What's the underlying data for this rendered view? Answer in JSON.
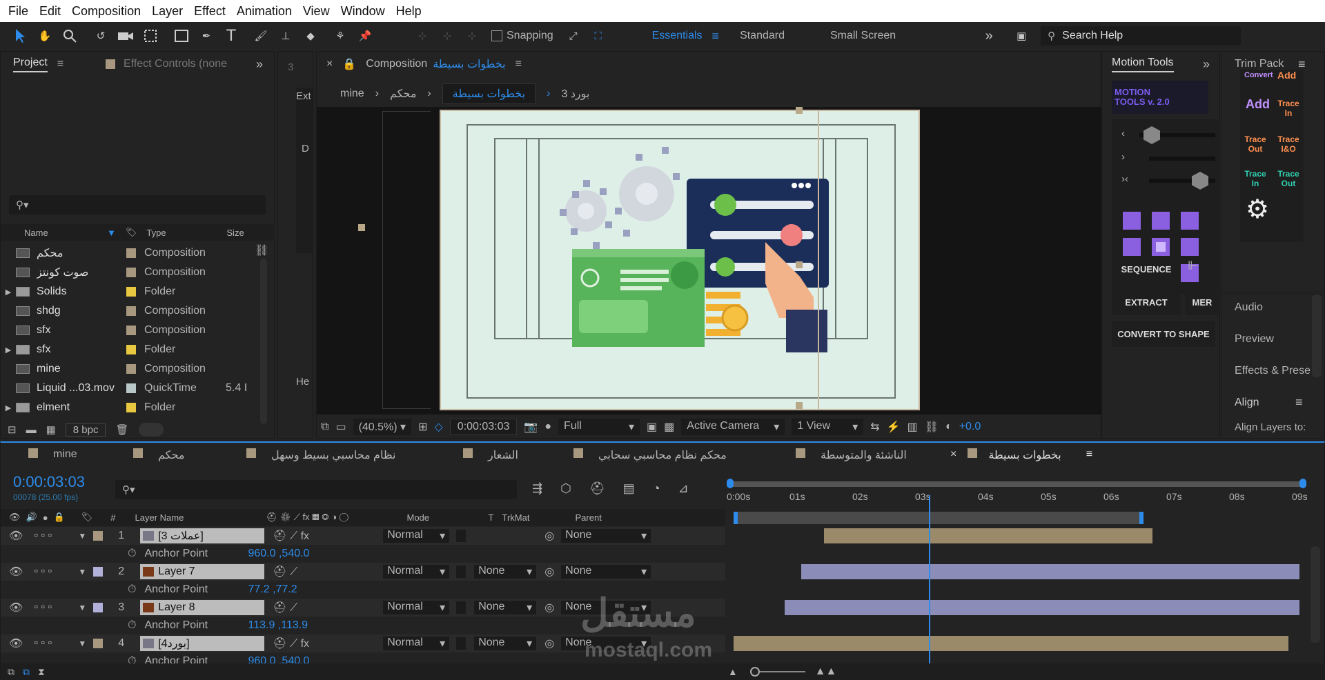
{
  "menu": [
    "File",
    "Edit",
    "Composition",
    "Layer",
    "Effect",
    "Animation",
    "View",
    "Window",
    "Help"
  ],
  "toolbar": {
    "snapping_label": "Snapping",
    "workspaces": [
      "Essentials",
      "Standard",
      "Small Screen"
    ],
    "active_workspace": "Essentials",
    "search_placeholder": "Search Help"
  },
  "project_panel": {
    "tab": "Project",
    "tab2": "Effect Controls (none",
    "columns": {
      "name": "Name",
      "type": "Type",
      "size": "Size"
    },
    "items": [
      {
        "name": "محكم",
        "type": "Composition",
        "size": "",
        "color": "#a89880",
        "kind": "comp"
      },
      {
        "name": "صوت كونتز",
        "type": "Composition",
        "size": "",
        "color": "#a89880",
        "kind": "comp"
      },
      {
        "name": "Solids",
        "type": "Folder",
        "size": "",
        "color": "#e8c840",
        "kind": "folder"
      },
      {
        "name": "shdg",
        "type": "Composition",
        "size": "",
        "color": "#a89880",
        "kind": "comp"
      },
      {
        "name": "sfx",
        "type": "Composition",
        "size": "",
        "color": "#a89880",
        "kind": "comp"
      },
      {
        "name": "sfx",
        "type": "Folder",
        "size": "",
        "color": "#e8c840",
        "kind": "folder"
      },
      {
        "name": "mine",
        "type": "Composition",
        "size": "",
        "color": "#a89880",
        "kind": "comp"
      },
      {
        "name": "Liquid ...03.mov",
        "type": "QuickTime",
        "size": "5.4 I",
        "color": "#b8c8c8",
        "kind": "mov"
      },
      {
        "name": "elment",
        "type": "Folder",
        "size": "",
        "color": "#e8c840",
        "kind": "folder"
      }
    ],
    "bpc": "8 bpc"
  },
  "side_strip": {
    "a": "Ext",
    "b": "D",
    "c": "He"
  },
  "composition": {
    "tab_label": "Composition",
    "tab_name": "بخطوات بسيطة",
    "breadcrumbs": [
      "mine",
      "محكم",
      "بخطوات بسيطة",
      "بورد 3"
    ],
    "zoom": "(40.5%)",
    "timecode": "0:00:03:03",
    "resolution": "Full",
    "camera": "Active Camera",
    "view": "1 View",
    "exposure": "+0.0"
  },
  "motion_tools": {
    "tab": "Motion Tools",
    "logo_line1": "MOTION",
    "logo_line2": "TOOLS v. 2.0",
    "buttons": [
      "SEQUENCE",
      "EXTRACT",
      "MER",
      "CONVERT TO SHAPE"
    ]
  },
  "trim_pack": {
    "tab": "Trim Pack",
    "labels": [
      "Convert",
      "Add",
      "Add",
      "Trace In",
      "Trace Out",
      "Trace I&O",
      "Trace In",
      "Trace Out"
    ]
  },
  "right_panels": [
    "Audio",
    "Preview",
    "Effects & Prese",
    "Align"
  ],
  "align_sub": "Align Layers to:",
  "timeline": {
    "tabs": [
      "mine",
      "محكم",
      "نظام محاسبي بسيط وسهل",
      "الشعار",
      "محكم نظام محاسبي سحابي",
      "الناشئة والمتوسطة",
      "بخطوات بسيطة"
    ],
    "timecode": "0:00:03:03",
    "frames": "00078 (25.00 fps)",
    "columns": {
      "num": "#",
      "layer_name": "Layer Name",
      "mode": "Mode",
      "t": "T",
      "trkmat": "TrkMat",
      "parent": "Parent"
    },
    "ruler": [
      "0:00s",
      "01s",
      "02s",
      "03s",
      "04s",
      "05s",
      "06s",
      "07s",
      "08s",
      "09s"
    ],
    "layers": [
      {
        "num": "1",
        "name": "[عملات 3]",
        "mode": "Normal",
        "trkmat": "",
        "parent": "None",
        "prop": "Anchor Point",
        "value": "960.0 ,540.0",
        "color": "#a89880",
        "fx": true,
        "start": 0.16,
        "end": 0.74,
        "bar": "#9b8a6a"
      },
      {
        "num": "2",
        "name": "Layer 7",
        "mode": "Normal",
        "trkmat": "None",
        "parent": "None",
        "prop": "Anchor Point",
        "value": "77.2 ,77.2",
        "color": "#b0b0d8",
        "fx": false,
        "start": 0.12,
        "end": 1.0,
        "bar": "#8c8cb8"
      },
      {
        "num": "3",
        "name": "Layer 8",
        "mode": "Normal",
        "trkmat": "None",
        "parent": "None",
        "prop": "Anchor Point",
        "value": "113.9 ,113.9",
        "color": "#b0b0d8",
        "fx": false,
        "start": 0.09,
        "end": 1.0,
        "bar": "#8c8cb8"
      },
      {
        "num": "4",
        "name": "[بورد4]",
        "mode": "Normal",
        "trkmat": "None",
        "parent": "None",
        "prop": "Anchor Point",
        "value": "960.0 ,540.0",
        "color": "#a89880",
        "fx": true,
        "start": 0.0,
        "end": 0.98,
        "bar": "#9b8a6a"
      }
    ],
    "playhead": 0.345
  },
  "watermark": {
    "arabic": "مستقل",
    "latin": "mostaql.com"
  }
}
